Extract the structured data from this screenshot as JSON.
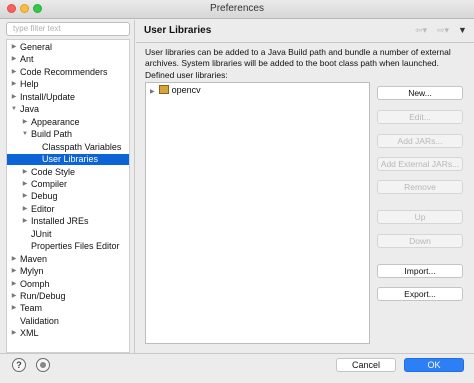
{
  "window": {
    "title": "Preferences"
  },
  "filter": {
    "placeholder": "type filter text"
  },
  "tree": [
    {
      "label": "General",
      "level": 0,
      "expander": "collapsed"
    },
    {
      "label": "Ant",
      "level": 0,
      "expander": "collapsed"
    },
    {
      "label": "Code Recommenders",
      "level": 0,
      "expander": "collapsed"
    },
    {
      "label": "Help",
      "level": 0,
      "expander": "collapsed"
    },
    {
      "label": "Install/Update",
      "level": 0,
      "expander": "collapsed"
    },
    {
      "label": "Java",
      "level": 0,
      "expander": "expanded"
    },
    {
      "label": "Appearance",
      "level": 1,
      "expander": "collapsed"
    },
    {
      "label": "Build Path",
      "level": 1,
      "expander": "expanded"
    },
    {
      "label": "Classpath Variables",
      "level": 2,
      "expander": "none"
    },
    {
      "label": "User Libraries",
      "level": 2,
      "expander": "none",
      "selected": true
    },
    {
      "label": "Code Style",
      "level": 1,
      "expander": "collapsed"
    },
    {
      "label": "Compiler",
      "level": 1,
      "expander": "collapsed"
    },
    {
      "label": "Debug",
      "level": 1,
      "expander": "collapsed"
    },
    {
      "label": "Editor",
      "level": 1,
      "expander": "collapsed"
    },
    {
      "label": "Installed JREs",
      "level": 1,
      "expander": "collapsed"
    },
    {
      "label": "JUnit",
      "level": 1,
      "expander": "none"
    },
    {
      "label": "Properties Files Editor",
      "level": 1,
      "expander": "none"
    },
    {
      "label": "Maven",
      "level": 0,
      "expander": "collapsed"
    },
    {
      "label": "Mylyn",
      "level": 0,
      "expander": "collapsed"
    },
    {
      "label": "Oomph",
      "level": 0,
      "expander": "collapsed"
    },
    {
      "label": "Run/Debug",
      "level": 0,
      "expander": "collapsed"
    },
    {
      "label": "Team",
      "level": 0,
      "expander": "collapsed"
    },
    {
      "label": "Validation",
      "level": 0,
      "expander": "none"
    },
    {
      "label": "XML",
      "level": 0,
      "expander": "collapsed"
    }
  ],
  "page": {
    "title": "User Libraries",
    "description": "User libraries can be added to a Java Build path and bundle a number of external archives. System libraries will be added to the boot class path when launched.",
    "defined_label": "Defined user libraries:",
    "libraries": [
      {
        "name": "opencv"
      }
    ]
  },
  "nav_icons": {
    "back": "back-arrow-icon",
    "forward": "forward-arrow-icon",
    "menu": "view-menu-icon"
  },
  "buttons": [
    {
      "label": "New...",
      "enabled": true
    },
    {
      "label": "Edit...",
      "enabled": false
    },
    {
      "label": "Add JARs...",
      "enabled": false
    },
    {
      "label": "Add External JARs...",
      "enabled": false
    },
    {
      "label": "Remove",
      "enabled": false
    },
    {
      "label": "Up",
      "enabled": false
    },
    {
      "label": "Down",
      "enabled": false
    },
    {
      "label": "Import...",
      "enabled": true
    },
    {
      "label": "Export...",
      "enabled": true
    }
  ],
  "footer": {
    "help": "?",
    "cancel": "Cancel",
    "ok": "OK"
  },
  "colors": {
    "selection": "#0c64d6",
    "ok_button": "#2d7ff5"
  }
}
